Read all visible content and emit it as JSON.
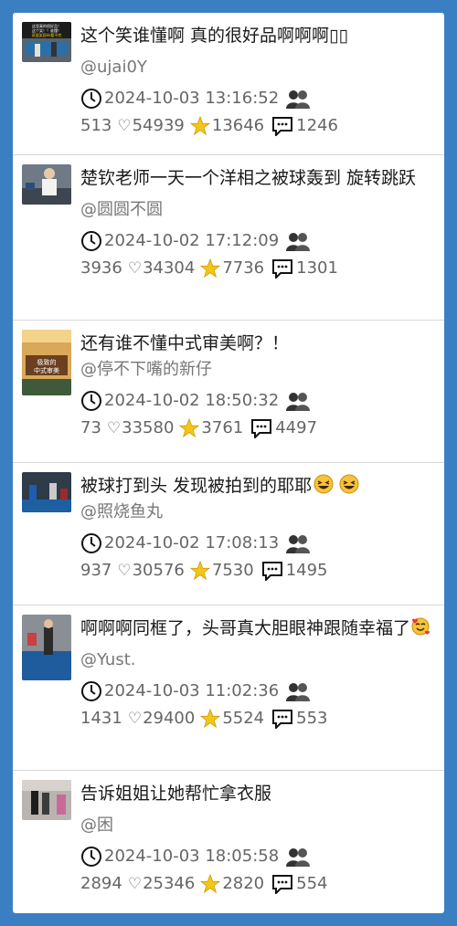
{
  "posts": [
    {
      "title": "这个笑谁懂啊 真的很好品啊啊啊▯▯",
      "author": "@ujai0Y",
      "datetime": "2024-10-03 13:16:52",
      "shares": "513",
      "likes": "54939",
      "stars": "13646",
      "comments": "1246",
      "thumb_text": "这里真的很好品！这个笑！！谁懂！双面笑容kk看不完啊啊啊"
    },
    {
      "title": "楚钦老师一天一个洋相之被球轰到 旋转跳跃",
      "author": "@圆圆不圆",
      "datetime": "2024-10-02 17:12:09",
      "shares": "3936",
      "likes": "34304",
      "stars": "7736",
      "comments": "1301"
    },
    {
      "title": "还有谁不懂中式审美啊？！",
      "author": "@停不下嘴的新仔",
      "datetime": "2024-10-02 18:50:32",
      "shares": "73",
      "likes": "33580",
      "stars": "3761",
      "comments": "4497",
      "thumb_text": "极致的中式审美"
    },
    {
      "title": "被球打到头 发现被拍到的耶耶",
      "author": "@照烧鱼丸",
      "datetime": "2024-10-02 17:08:13",
      "shares": "937",
      "likes": "30576",
      "stars": "7530",
      "comments": "1495"
    },
    {
      "title": "啊啊啊同框了，头哥真大胆眼神跟随幸福了",
      "author": "@Yust.",
      "datetime": "2024-10-03 11:02:36",
      "shares": "1431",
      "likes": "29400",
      "stars": "5524",
      "comments": "553"
    },
    {
      "title": "告诉姐姐让她帮忙拿衣服",
      "author": "@困",
      "datetime": "2024-10-03 18:05:58",
      "shares": "2894",
      "likes": "25346",
      "stars": "2820",
      "comments": "554"
    }
  ],
  "icons": {
    "clock": "clock-icon",
    "group": "group-icon",
    "heart": "♡",
    "star": "star-icon",
    "comment": "comment-icon"
  },
  "colors": {
    "background": "#3a7fc1",
    "card": "#ffffff",
    "star": "#f5c518"
  }
}
